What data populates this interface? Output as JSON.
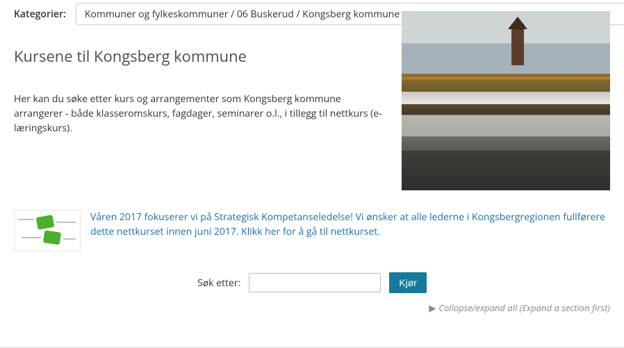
{
  "category": {
    "label": "Kategorier:",
    "value": "Kommuner og fylkeskommuner / 06 Buskerud / Kongsberg kommune"
  },
  "title": "Kursene til  Kongsberg kommune",
  "description": "Her kan du søke etter kurs og arrangementer som Kongsberg kommune arrangerer - både klasseromskurs, fagdager, seminarer o.l., i tillegg til nettkurs (e-læringskurs).",
  "highlight_text": "Våren 2017 fokuserer vi på Strategisk Kompetanseledelse! Vi ønsker at alle lederne i Kongsbergregionen fullførere dette nettkurset innen juni 2017.  Klikk her for å gå til nettkurset.",
  "search": {
    "label": "Søk etter:",
    "button": "Kjør",
    "value": ""
  },
  "collapse_text": "Collapse/expand all (Expand a section first)"
}
